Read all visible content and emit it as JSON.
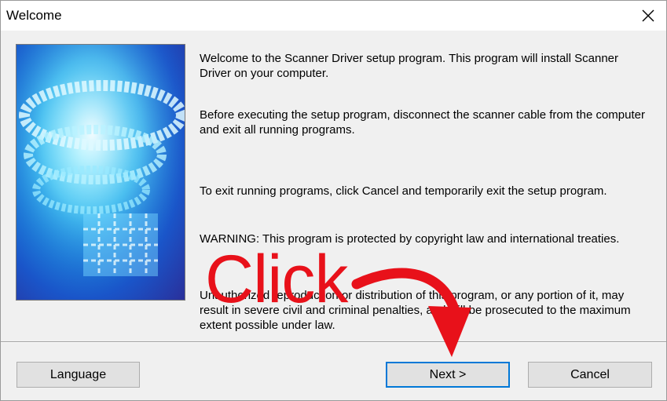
{
  "window": {
    "title": "Welcome"
  },
  "content": {
    "para1": "Welcome to the Scanner Driver setup program. This program will install Scanner Driver on your computer.",
    "para2": "Before executing the setup program, disconnect the scanner cable from the computer and exit all running programs.",
    "para3": "To exit running programs, click Cancel and temporarily exit the setup program.",
    "para4": "WARNING: This program is protected by copyright law and international treaties.",
    "para5": "Unauthorized reproduction or distribution of this program, or any portion of it, may result in severe civil and criminal penalties, and will be prosecuted to the maximum extent possible under law."
  },
  "buttons": {
    "language": "Language",
    "next": "Next >",
    "cancel": "Cancel"
  },
  "annotation": {
    "text": "Click",
    "color": "#e8111a"
  },
  "colors": {
    "focus_border": "#0078d7",
    "background": "#f0f0f0"
  }
}
